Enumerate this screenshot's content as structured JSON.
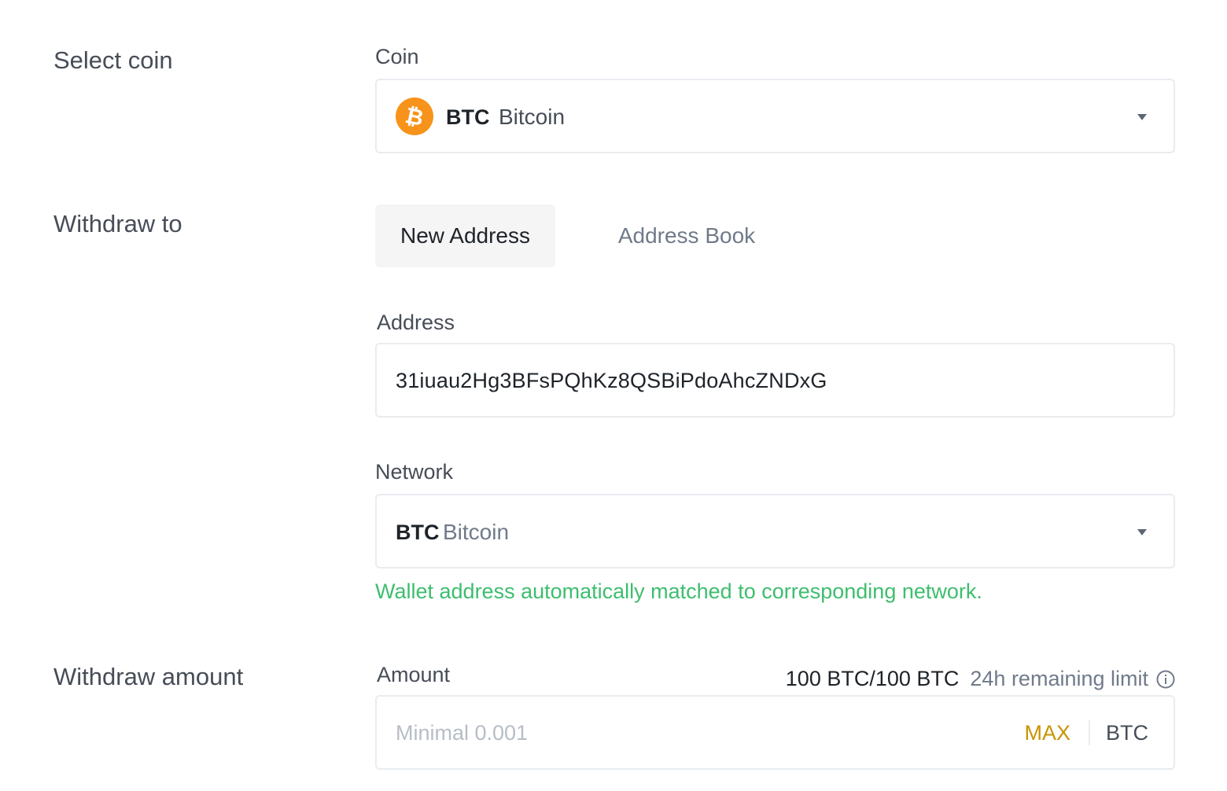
{
  "sections": {
    "select_coin": "Select coin",
    "withdraw_to": "Withdraw to",
    "withdraw_amount": "Withdraw amount"
  },
  "coin": {
    "label": "Coin",
    "symbol": "BTC",
    "name": "Bitcoin",
    "icon": "bitcoin-icon",
    "icon_color": "#f7931a"
  },
  "tabs": [
    {
      "label": "New Address",
      "active": true
    },
    {
      "label": "Address Book",
      "active": false
    }
  ],
  "address": {
    "label": "Address",
    "value": "31iuau2Hg3BFsPQhKz8QSBiPdoAhcZNDxG"
  },
  "network": {
    "label": "Network",
    "symbol": "BTC",
    "name": "Bitcoin",
    "helper": "Wallet address automatically matched to corresponding network.",
    "helper_color": "#3dbe6e"
  },
  "amount": {
    "label": "Amount",
    "limit_value": "100 BTC/100 BTC",
    "limit_label": "24h remaining limit",
    "placeholder": "Minimal 0.001",
    "max_label": "MAX",
    "unit": "BTC",
    "accent_color": "#c99400"
  }
}
